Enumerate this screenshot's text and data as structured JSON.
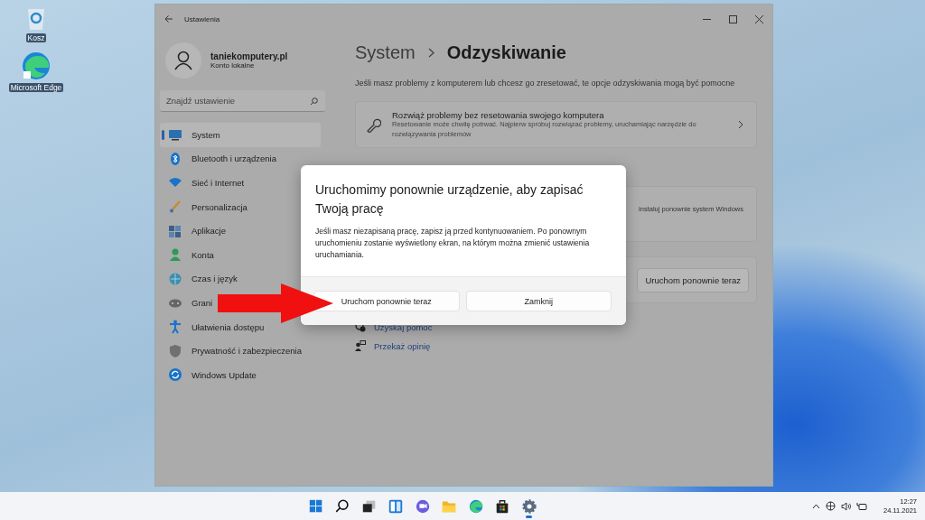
{
  "desktop_icons": [
    {
      "label": "Kosz",
      "kind": "recycle"
    },
    {
      "label": "Microsoft Edge",
      "kind": "edge"
    }
  ],
  "window": {
    "title": "Ustawienia",
    "account": {
      "name": "taniekomputery.pl",
      "type": "Konto lokalne"
    },
    "search": {
      "placeholder": "Znajdź ustawienie"
    },
    "sidebar": {
      "items": [
        {
          "label": "System",
          "kind": "system",
          "selected": true
        },
        {
          "label": "Bluetooth i urządzenia",
          "kind": "bluetooth",
          "selected": false
        },
        {
          "label": "Sieć i Internet",
          "kind": "network",
          "selected": false
        },
        {
          "label": "Personalizacja",
          "kind": "brush",
          "selected": false
        },
        {
          "label": "Aplikacje",
          "kind": "apps",
          "selected": false
        },
        {
          "label": "Konta",
          "kind": "person",
          "selected": false
        },
        {
          "label": "Czas i język",
          "kind": "globe",
          "selected": false
        },
        {
          "label": "Grani",
          "kind": "gamepad",
          "selected": false
        },
        {
          "label": "Ułatwienia dostępu",
          "kind": "accessibility",
          "selected": false
        },
        {
          "label": "Prywatność i zabezpieczenia",
          "kind": "shield",
          "selected": false
        },
        {
          "label": "Windows Update",
          "kind": "update",
          "selected": false
        }
      ]
    },
    "breadcrumb": {
      "parent": "System",
      "current": "Odzyskiwanie"
    },
    "description": "Jeśli masz problemy z komputerem lub chcesz go zresetować, te opcje odzyskiwania mogą być pomocne",
    "cards": [
      {
        "kind": "full",
        "title": "Rozwiąż problemy bez resetowania swojego komputera",
        "description": "Resetowanie może chwilę potrwać. Najpierw spróbuj rozwiązać problemy, uruchamiając narzędzie do rozwiązywania problemów"
      },
      {
        "kind": "text",
        "text": "instaluj ponownie system Windows"
      },
      {
        "kind": "button",
        "label": "Uruchom ponownie teraz"
      }
    ],
    "links": [
      {
        "label": "Uzyskaj pomoc",
        "kind": "help"
      },
      {
        "label": "Przekaż opinię",
        "kind": "feedback"
      }
    ]
  },
  "dialog": {
    "title": "Uruchomimy ponownie urządzenie, aby zapisać Twoją pracę",
    "body": "Jeśli masz niezapisaną pracę, zapisz ją przed kontynuowaniem. Po ponownym uruchomieniu zostanie wyświetlony ekran, na którym można zmienić ustawienia uruchamiania.",
    "buttons": [
      {
        "label": "Uruchom ponownie teraz"
      },
      {
        "label": "Zamknij"
      }
    ]
  },
  "taskbar": {
    "apps": [
      {
        "kind": "start",
        "active": false
      },
      {
        "kind": "search",
        "active": false
      },
      {
        "kind": "taskview",
        "active": false
      },
      {
        "kind": "widgets",
        "active": false
      },
      {
        "kind": "chat",
        "active": false
      },
      {
        "kind": "folder",
        "active": false
      },
      {
        "kind": "edge",
        "active": false
      },
      {
        "kind": "store",
        "active": false
      },
      {
        "kind": "settings",
        "active": true
      }
    ],
    "clock": {
      "time": "12:27",
      "date": "24.11.2021"
    }
  }
}
